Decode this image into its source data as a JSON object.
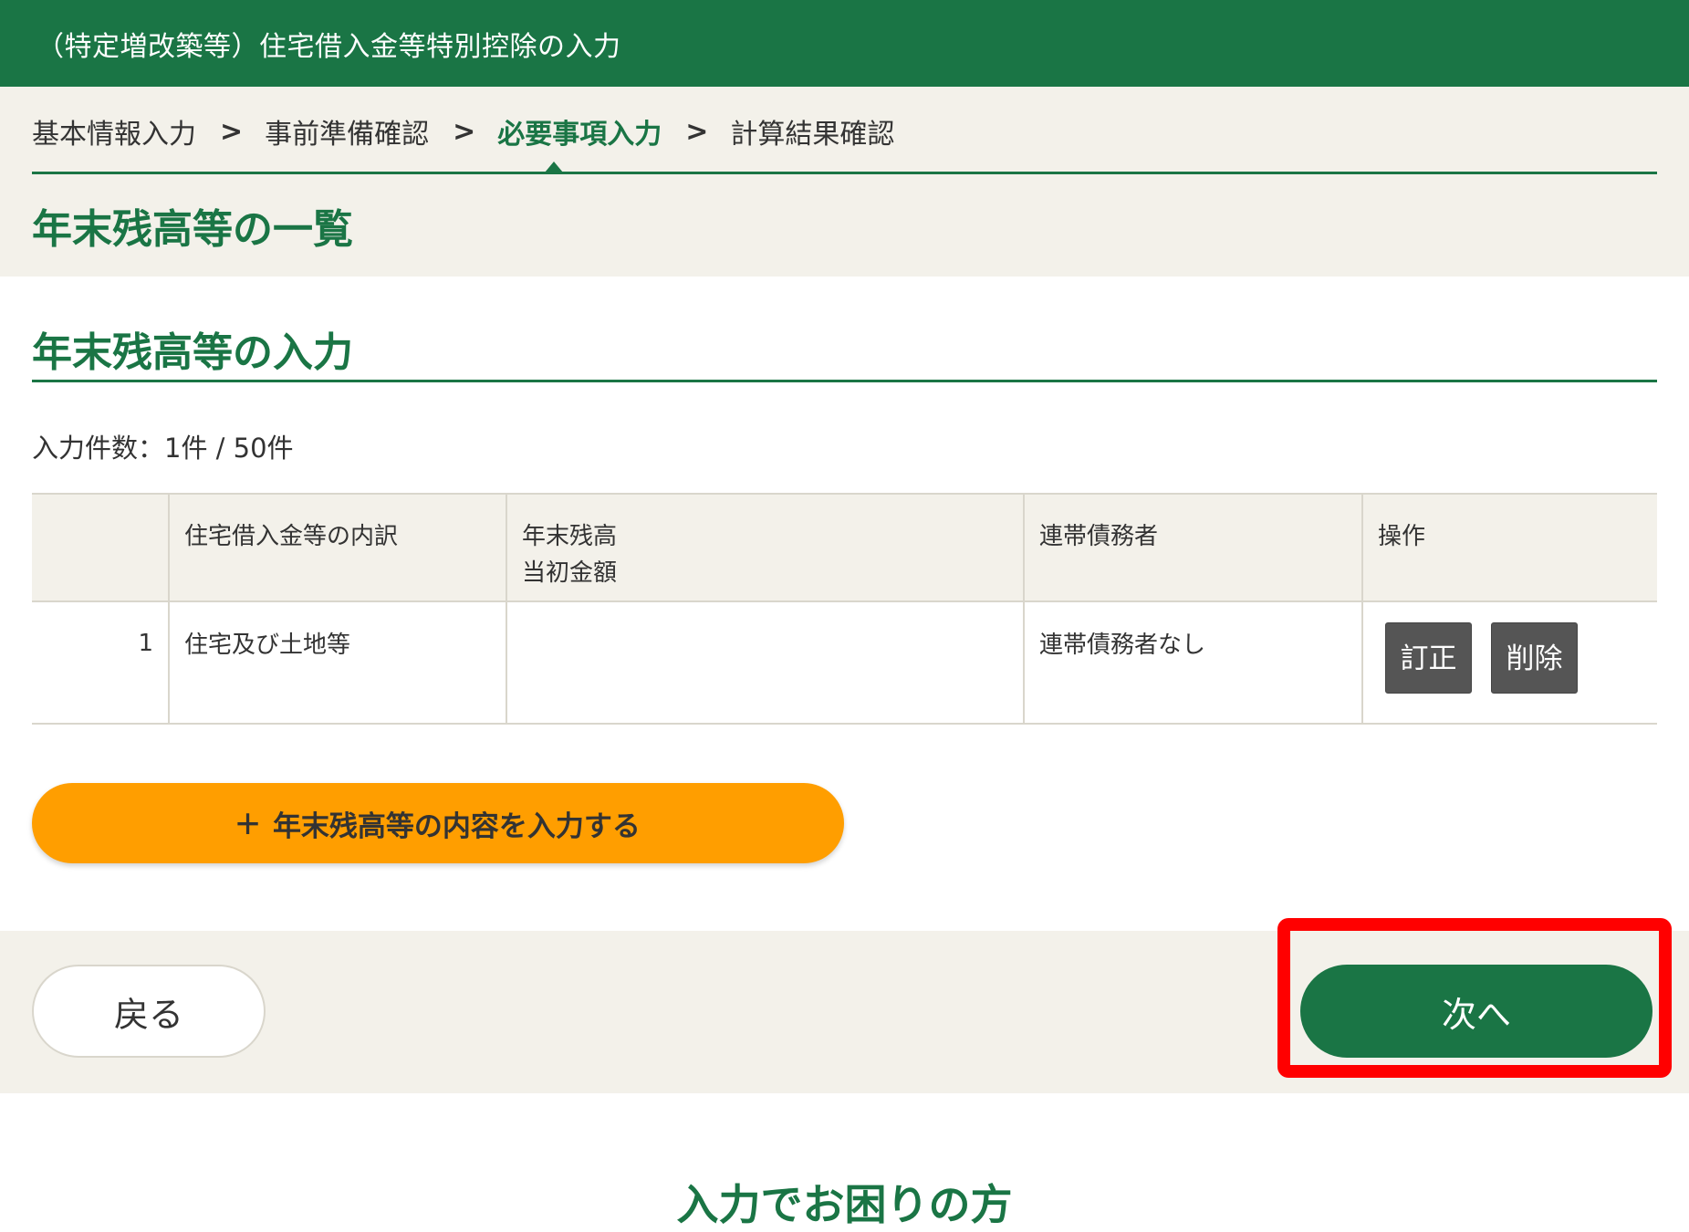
{
  "theme": {
    "brand": "#1a7545",
    "accent": "#ff9e00",
    "background_beige": "#f3f1ea",
    "highlight": "#ff0000"
  },
  "header": {
    "title": "（特定増改築等）住宅借入金等特別控除の入力"
  },
  "steps": [
    {
      "label": "基本情報入力",
      "current": false
    },
    {
      "label": "事前準備確認",
      "current": false
    },
    {
      "label": "必要事項入力",
      "current": true
    },
    {
      "label": "計算結果確認",
      "current": false
    }
  ],
  "steps_separator": ">",
  "page_title": "年末残高等の一覧",
  "section_title": "年末残高等の入力",
  "count_text": "入力件数：1件 / 50件",
  "table": {
    "headers": [
      "",
      "住宅借入金等の内訳",
      "年末残高",
      "当初金額",
      "連帯債務者",
      "操作"
    ],
    "rows": [
      {
        "no": "1",
        "breakdown": "住宅及び土地等",
        "balance": "",
        "joint_debtor": "連帯債務者なし"
      }
    ],
    "edit_label": "訂正",
    "delete_label": "削除"
  },
  "add_button": {
    "icon": "plus-icon",
    "label": "年末残高等の内容を入力する"
  },
  "footer": {
    "back_label": "戻る",
    "next_label": "次へ"
  },
  "help_title": "入力でお困りの方"
}
